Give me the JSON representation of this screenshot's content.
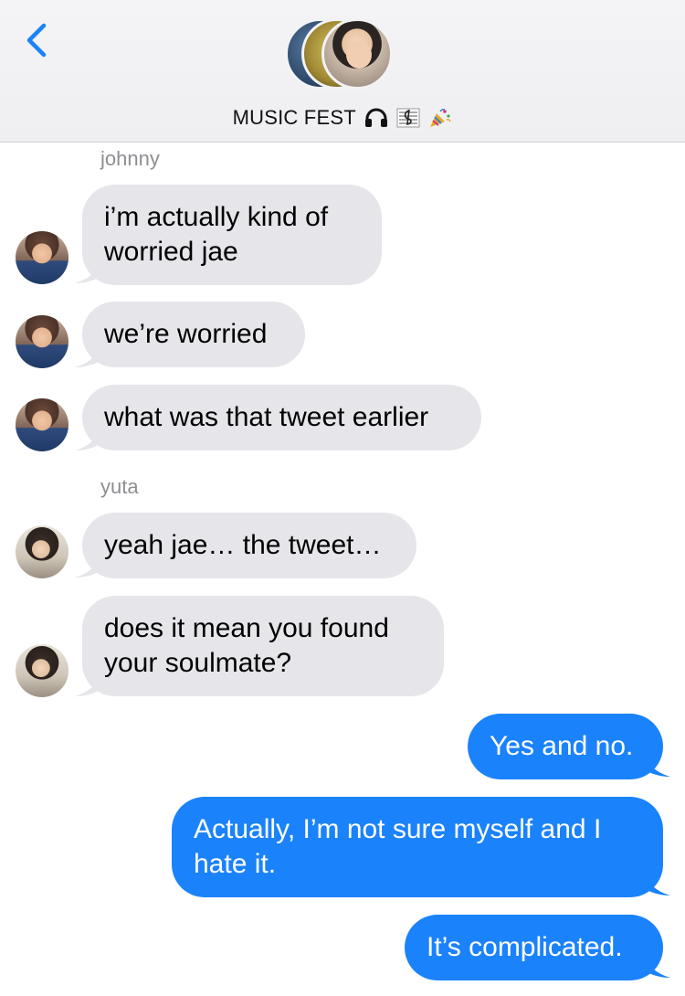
{
  "header": {
    "title": "MUSIC FEST",
    "title_emojis": [
      "headphones-emoji",
      "musical-score-emoji",
      "party-popper-emoji"
    ]
  },
  "messages": [
    {
      "sender": "johnny",
      "text": "i’m actually kind of worried jae",
      "direction": "incoming"
    },
    {
      "text": "we’re worried",
      "direction": "incoming"
    },
    {
      "text": "what was that tweet earlier",
      "direction": "incoming"
    },
    {
      "sender": "yuta",
      "text": "yeah jae… the tweet…",
      "direction": "incoming"
    },
    {
      "text": "does it mean you found your soulmate?",
      "direction": "incoming"
    },
    {
      "text": "Yes and no.",
      "direction": "outgoing"
    },
    {
      "text": "Actually, I’m not sure myself and I hate it.",
      "direction": "outgoing"
    },
    {
      "text": "It’s complicated.",
      "direction": "outgoing"
    }
  ],
  "colors": {
    "incoming_bubble": "#e5e5ea",
    "outgoing_bubble": "#1a82fb",
    "accent": "#1a82fb"
  }
}
